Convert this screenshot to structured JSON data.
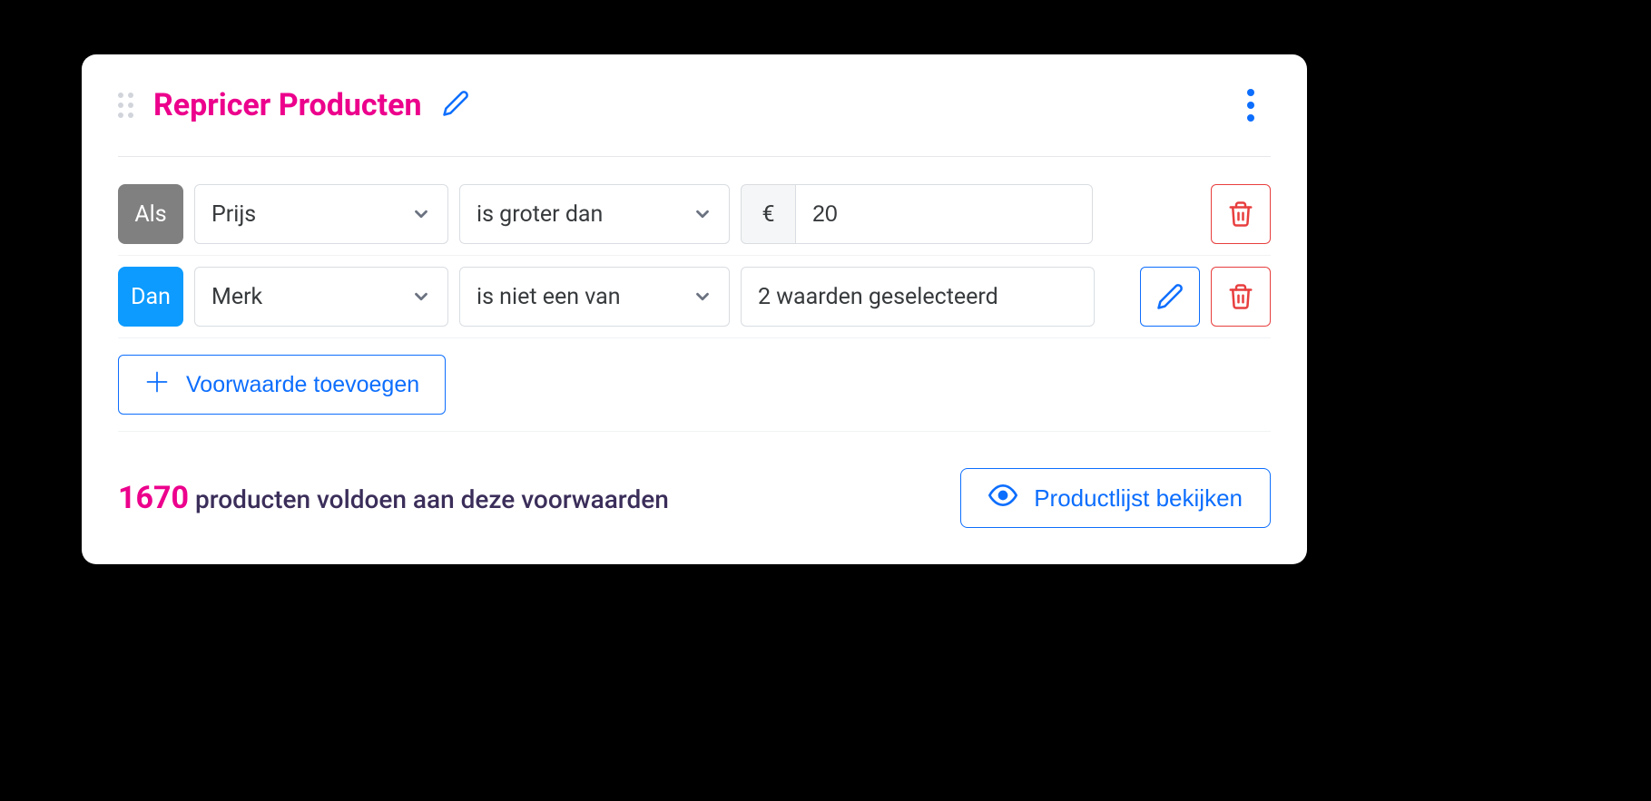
{
  "header": {
    "title": "Repricer Producten"
  },
  "rows": [
    {
      "chip": "Als",
      "chip_class": "chip-gray",
      "field": "Prijs",
      "operator": "is groter dan",
      "prefix": "€",
      "value": "20",
      "has_edit": false
    },
    {
      "chip": "Dan",
      "chip_class": "chip-blue",
      "field": "Merk",
      "operator": "is niet een van",
      "value_display": "2 waarden geselecteerd",
      "has_edit": true
    }
  ],
  "add_button": "Voorwaarde toevoegen",
  "footer": {
    "count": "1670",
    "text": "producten voldoen aan deze voorwaarden",
    "view_button": "Productlijst bekijken"
  }
}
